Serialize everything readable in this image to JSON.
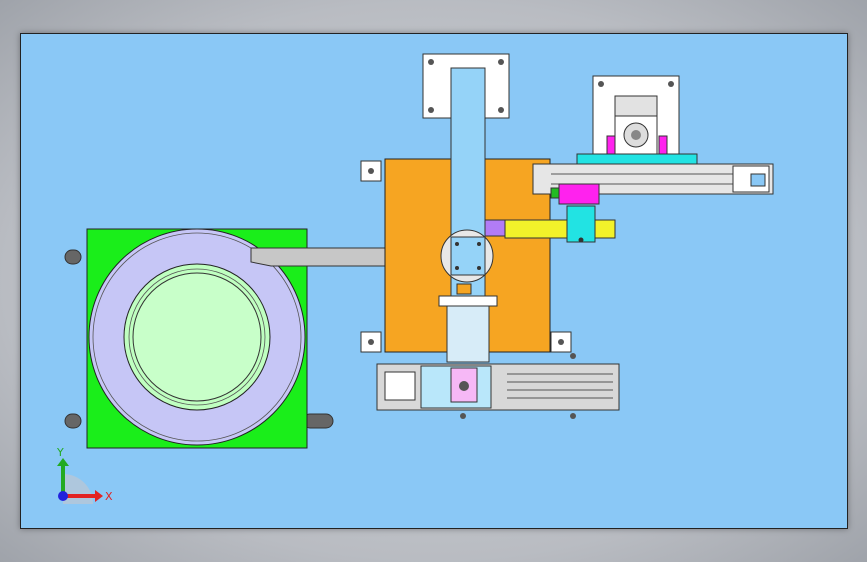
{
  "scene": {
    "background_color": "#8ac8f6",
    "colors": {
      "green_base": "#1aee1a",
      "ring_lavender": "#c6c6f6",
      "bowl_light_green": "#bfffc0",
      "orange_plate": "#f6a522",
      "arm_blue": "#95d3f8",
      "magenta_block": "#ff22ee",
      "yellow_cylinder": "#f2f22a",
      "cyan_bar": "#22e3e3",
      "pink_block": "#f6b8f6",
      "purple_cylinder": "#b27cf6",
      "gray_rail": "#d8d8d8"
    }
  },
  "triad": {
    "y_label": "Y",
    "x_label": "X",
    "y_color": "#22aa22",
    "x_color": "#e22222",
    "z_color": "#2222dd"
  }
}
